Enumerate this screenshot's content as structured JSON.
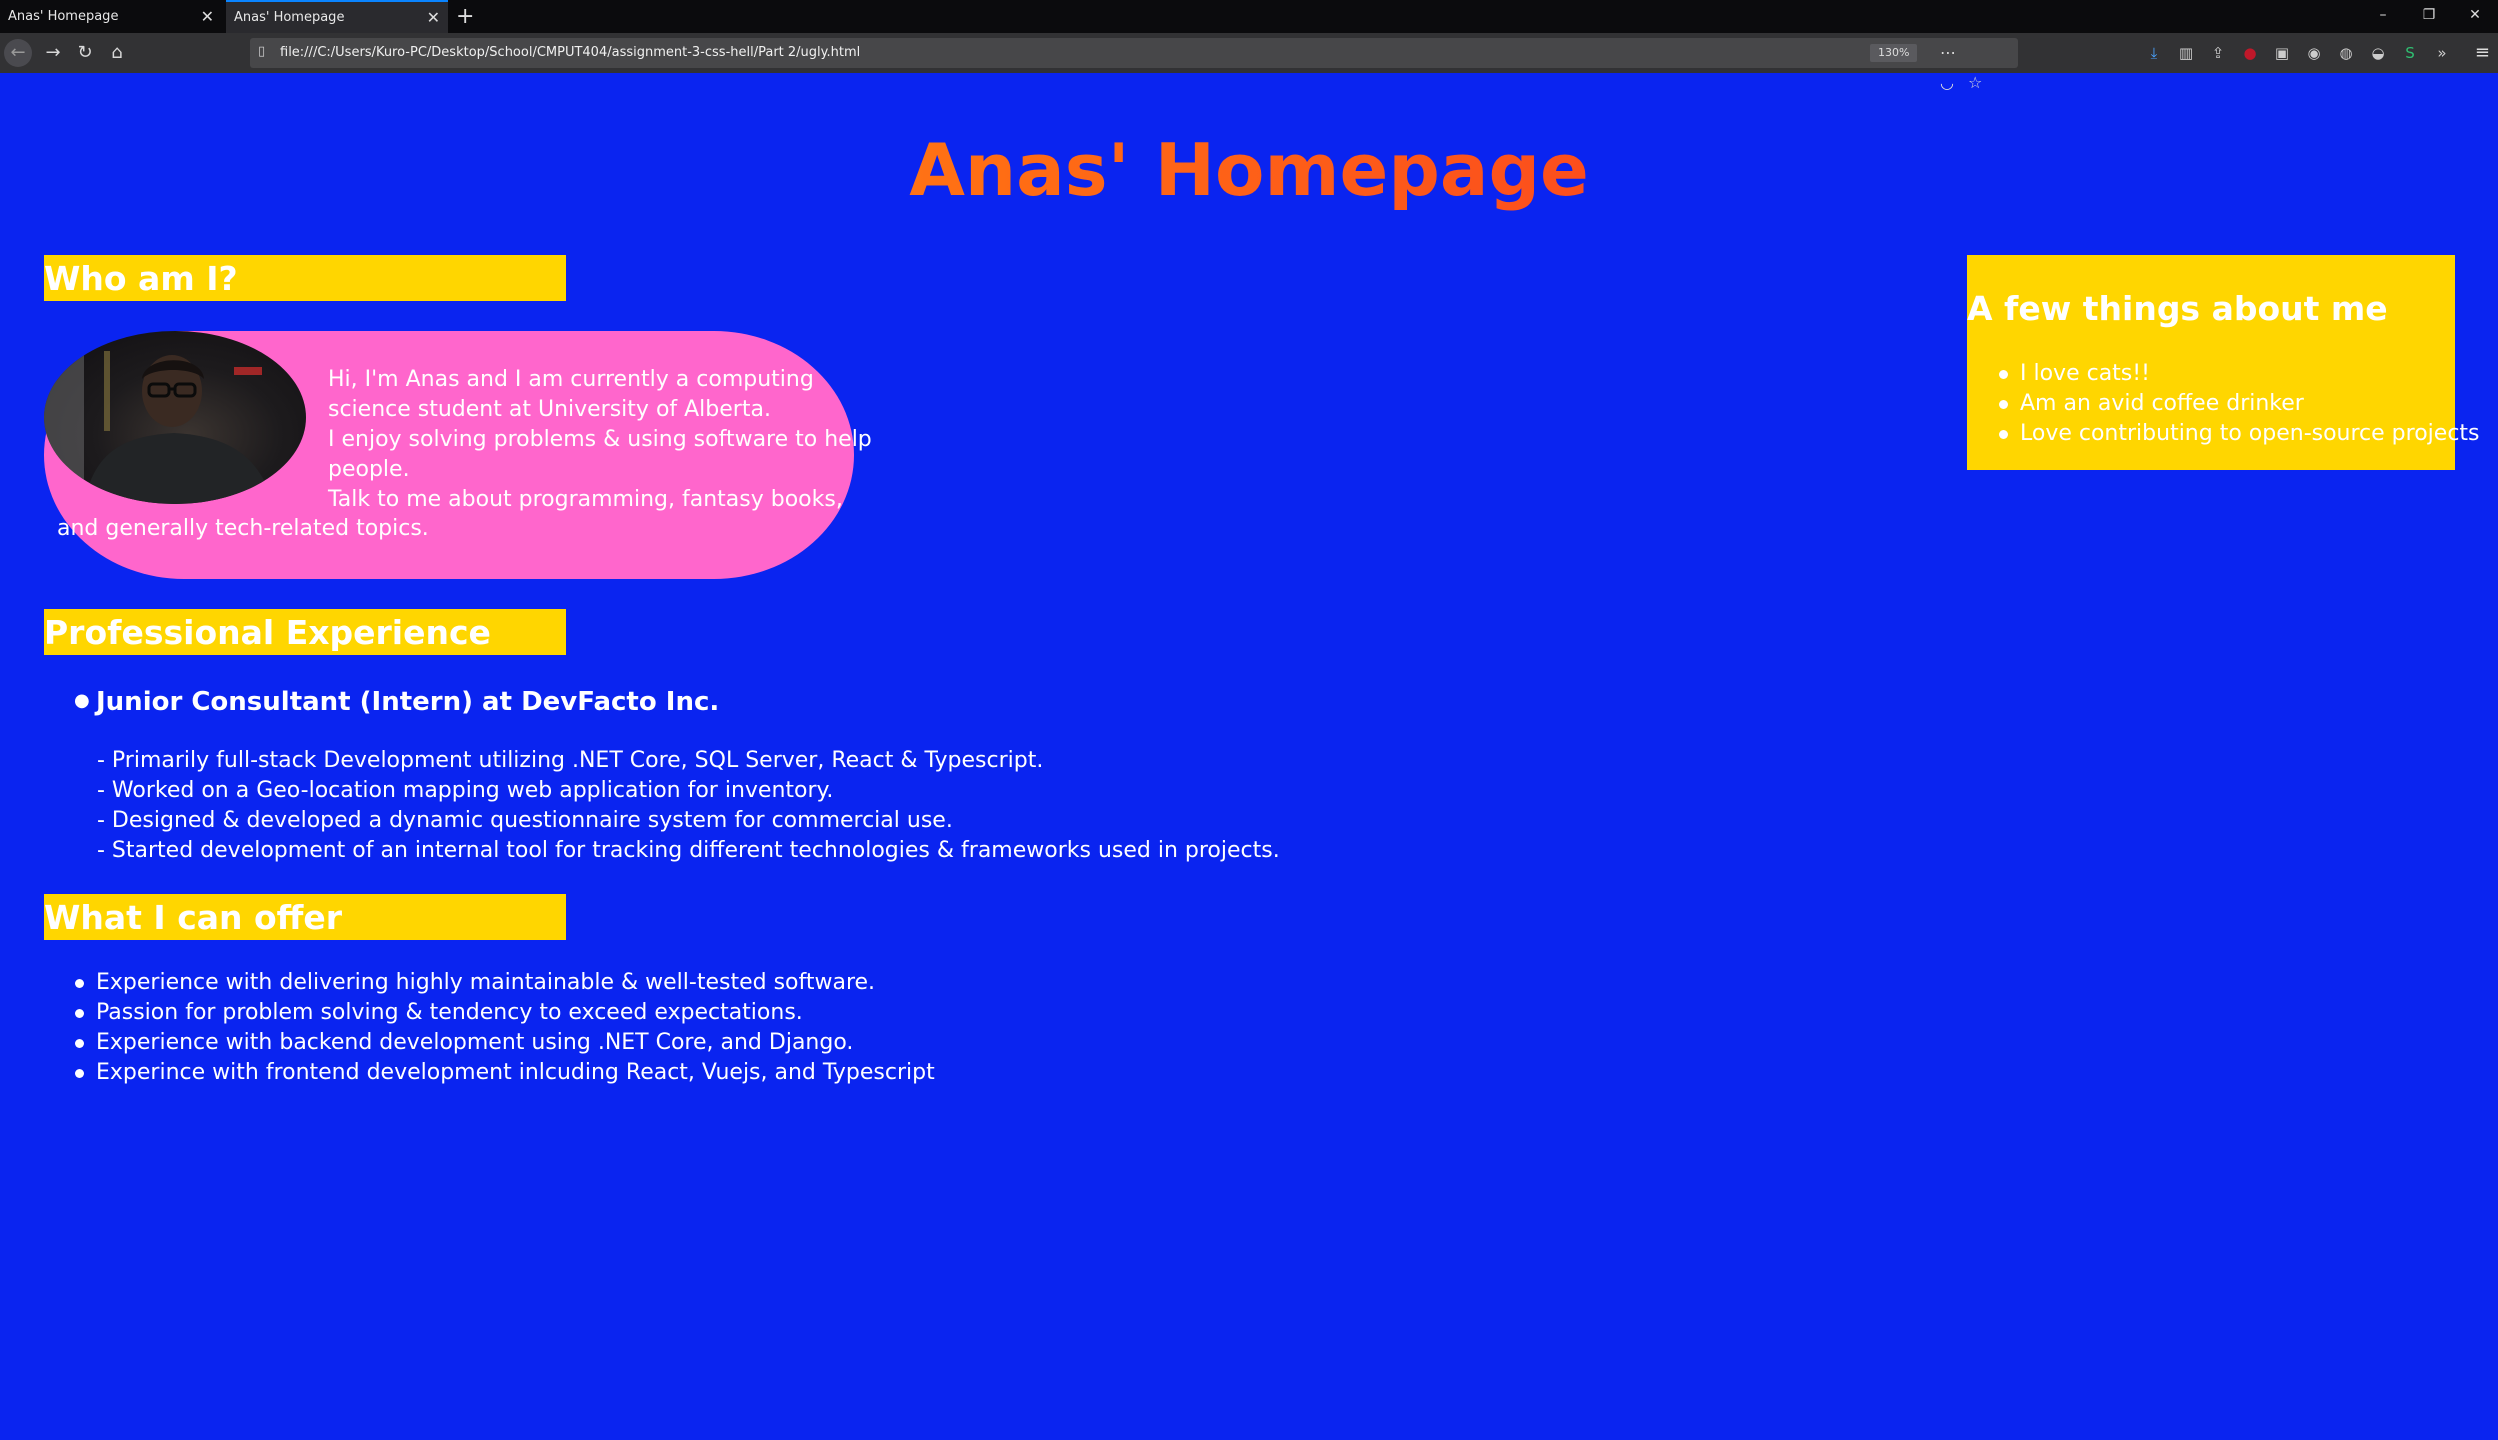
{
  "browser": {
    "tabs": [
      {
        "label": "Anas' Homepage",
        "active": false
      },
      {
        "label": "Anas' Homepage",
        "active": true
      }
    ],
    "new_tab_icon": "plus-icon",
    "url": "file:///C:/Users/Kuro-PC/Desktop/School/CMPUT404/assignment-3-css-hell/Part 2/ugly.html",
    "zoom": "130%"
  },
  "page": {
    "title_part1": "Anas'",
    "title_part2": "Homepage",
    "who": {
      "heading": "Who am I?",
      "bio_line1": "Hi, I'm Anas and I am currently a computing science student at University of Alberta.",
      "bio_line2": "I enjoy solving problems & using software to help people.",
      "bio_line3": "Talk to me about programming, fantasy books,",
      "bio_line4": "and generally tech-related topics."
    },
    "experience": {
      "heading": "Professional Experience",
      "job_title": "Junior Consultant (Intern) at DevFacto Inc.",
      "details": [
        "- Primarily full-stack Development utilizing .NET Core, SQL Server, React & Typescript.",
        "- Worked on a Geo-location mapping web application for inventory.",
        "- Designed & developed a dynamic questionnaire system for commercial use.",
        "- Started development of an internal tool for tracking different technologies & frameworks used in projects."
      ]
    },
    "offer": {
      "heading": "What I can offer",
      "items": [
        "Experience with delivering highly maintainable & well-tested software.",
        "Passion for problem solving & tendency to exceed expectations.",
        "Experience with backend development using .NET Core, and Django.",
        "Experince with frontend development inlcuding React, Vuejs, and Typescript"
      ]
    },
    "about": {
      "heading": "A few things about me",
      "items": [
        "I love cats!!",
        "Am an avid coffee drinker",
        "Love contributing to open-source projects"
      ]
    }
  },
  "colors": {
    "page_background": "#0a24f0",
    "heading_background": "#ffd600",
    "bio_background": "#ff66cc",
    "title_gradient": [
      "#ffa51f",
      "#f61e2a"
    ]
  }
}
